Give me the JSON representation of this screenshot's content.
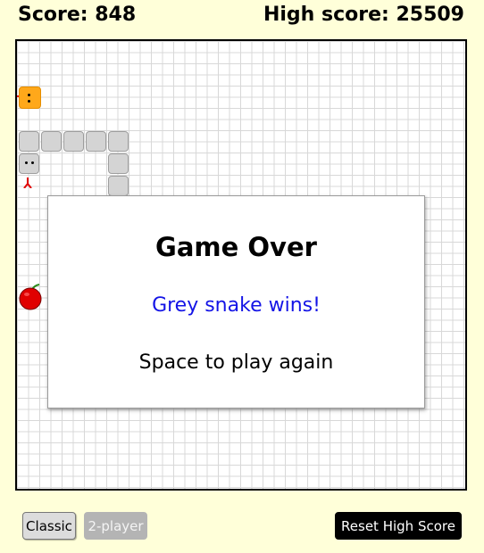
{
  "scoreboard": {
    "score_text": "Score: 848",
    "high_score_text": "High score: 25509"
  },
  "overlay": {
    "title": "Game Over",
    "winner_text": "Grey snake wins!",
    "hint_text": "Space to play again"
  },
  "buttons": {
    "classic_label": "Classic",
    "two_player_label": "2-player",
    "reset_label": "Reset High Score"
  },
  "colors": {
    "background": "#ffffd9",
    "grey_snake": "#d4d4d4",
    "orange_snake": "#ffa81a",
    "winner_text": "#1414e6",
    "apple": "#e00000"
  },
  "icons": {
    "apple": "apple-icon",
    "tongue": "snake-tongue-icon"
  }
}
